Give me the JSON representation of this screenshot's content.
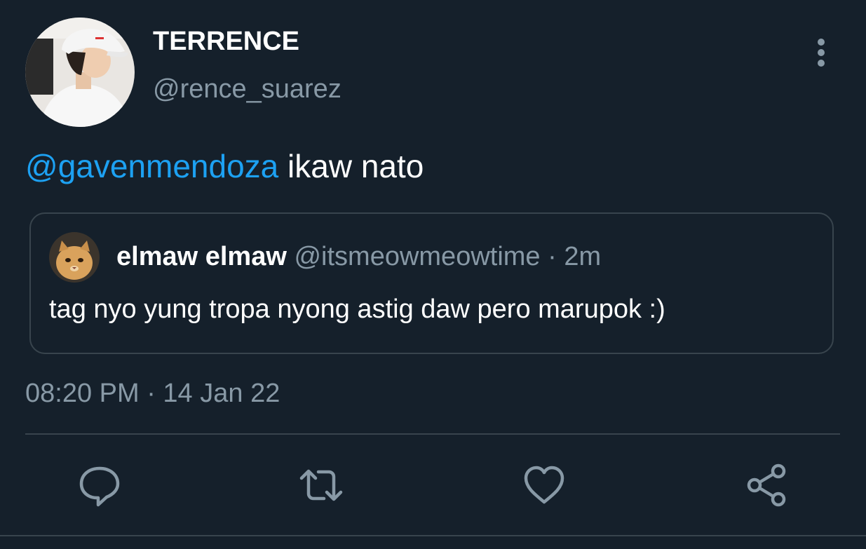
{
  "author": {
    "display_name": "TERRENCE",
    "handle": "@rence_suarez"
  },
  "tweet": {
    "mention": "@gavenmendoza",
    "text": " ikaw nato",
    "timestamp": "08:20 PM · 14 Jan 22"
  },
  "quoted_tweet": {
    "display_name": "elmaw elmaw",
    "meta": " @itsmeowmeowtime · 2m",
    "text": "tag nyo yung tropa nyong astig daw pero marupok :)"
  },
  "actions": {
    "icons": [
      "reply-icon",
      "retweet-icon",
      "like-icon",
      "share-icon"
    ]
  },
  "colors": {
    "background": "#15202b",
    "primary_text": "#ffffff",
    "secondary_text": "#8899a6",
    "accent": "#1da1f2",
    "border": "#38444d"
  }
}
